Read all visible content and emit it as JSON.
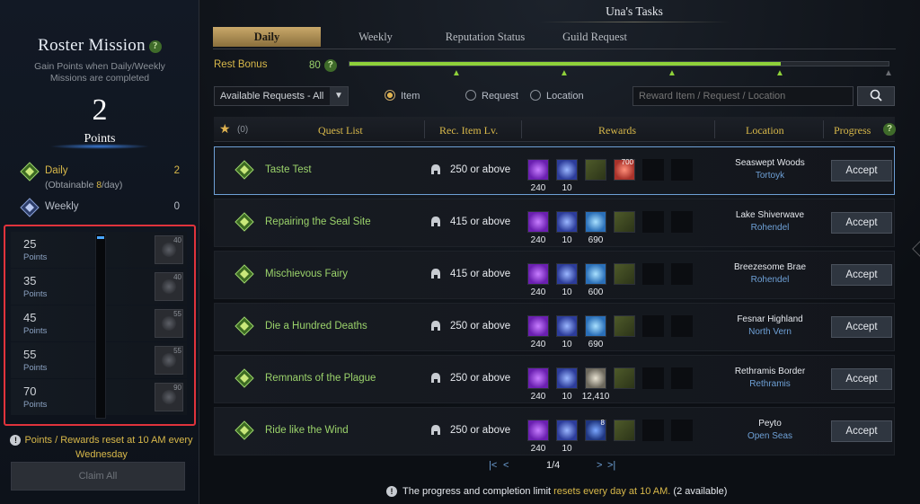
{
  "window": {
    "title": "Una's Tasks"
  },
  "colors": {
    "accent_gold": "#d9b94a",
    "quest_green": "#9bd36b",
    "region_blue": "#6ea0d6",
    "highlight_red": "#e0333c",
    "rest_bar": "#8fd13a"
  },
  "roster": {
    "title": "Roster Mission",
    "help": "?",
    "description": "Gain Points when Daily/Weekly Missions are completed",
    "points_value": "2",
    "points_label": "Points",
    "daily_label": "Daily",
    "daily_value": "2",
    "daily_sub_pre": "(Obtainable ",
    "daily_sub_num": "8",
    "daily_sub_post": "/day)",
    "weekly_label": "Weekly",
    "weekly_value": "0",
    "tiers": [
      {
        "points": "25",
        "label": "Points",
        "reward_qty": "40"
      },
      {
        "points": "35",
        "label": "Points",
        "reward_qty": "40"
      },
      {
        "points": "45",
        "label": "Points",
        "reward_qty": "55"
      },
      {
        "points": "55",
        "label": "Points",
        "reward_qty": "55"
      },
      {
        "points": "70",
        "label": "Points",
        "reward_qty": "90"
      }
    ],
    "progress_fraction": 0.03,
    "reset_note": "Points / Rewards reset at 10 AM every Wednesday",
    "claim_all": "Claim All"
  },
  "tabs": [
    {
      "label": "Daily",
      "active": true
    },
    {
      "label": "Weekly",
      "active": false
    },
    {
      "label": "Reputation Status",
      "active": false
    },
    {
      "label": "Guild Request",
      "active": false
    }
  ],
  "rest_bonus": {
    "label": "Rest Bonus",
    "value": "80",
    "help": "?",
    "fraction": 0.8
  },
  "filters": {
    "select_value": "Available Requests - All",
    "radio_item": "Item",
    "radio_request": "Request",
    "radio_location": "Location",
    "selected_radio": "Item",
    "search_placeholder": "Reward Item / Request / Location"
  },
  "table": {
    "fav_count": "(0)",
    "headers": {
      "quest": "Quest List",
      "level": "Rec. Item Lv.",
      "rewards": "Rewards",
      "location": "Location",
      "progress": "Progress",
      "help": "?"
    },
    "accept_label": "Accept",
    "rows": [
      {
        "name": "Taste Test",
        "level": "250 or above",
        "location": "Seaswept Woods",
        "region": "Tortoyk",
        "rewards": [
          {
            "icon": "purple-gem-icon",
            "qty": "240"
          },
          {
            "icon": "blue-gem-icon",
            "qty": "10"
          },
          {
            "icon": "feather-icon",
            "qty": ""
          },
          {
            "icon": "food-icon",
            "qty": "",
            "badge": "700"
          }
        ]
      },
      {
        "name": "Repairing the Seal Site",
        "level": "415 or above",
        "location": "Lake Shiverwave",
        "region": "Rohendel",
        "rewards": [
          {
            "icon": "purple-gem-icon",
            "qty": "240"
          },
          {
            "icon": "blue-gem-icon",
            "qty": "10"
          },
          {
            "icon": "blue-crystal-icon",
            "qty": "690"
          },
          {
            "icon": "feather-icon",
            "qty": ""
          }
        ]
      },
      {
        "name": "Mischievous Fairy",
        "level": "415 or above",
        "location": "Breezesome Brae",
        "region": "Rohendel",
        "rewards": [
          {
            "icon": "purple-gem-icon",
            "qty": "240"
          },
          {
            "icon": "blue-gem-icon",
            "qty": "10"
          },
          {
            "icon": "blue-crystal-icon",
            "qty": "600"
          },
          {
            "icon": "feather-icon",
            "qty": ""
          }
        ]
      },
      {
        "name": "Die a Hundred Deaths",
        "level": "250 or above",
        "location": "Fesnar Highland",
        "region": "North Vern",
        "rewards": [
          {
            "icon": "purple-gem-icon",
            "qty": "240"
          },
          {
            "icon": "blue-gem-icon",
            "qty": "10"
          },
          {
            "icon": "blue-crystal-icon",
            "qty": "690"
          },
          {
            "icon": "feather-icon",
            "qty": ""
          }
        ]
      },
      {
        "name": "Remnants of the Plague",
        "level": "250 or above",
        "location": "Rethramis Border",
        "region": "Rethramis",
        "rewards": [
          {
            "icon": "purple-gem-icon",
            "qty": "240"
          },
          {
            "icon": "blue-gem-icon",
            "qty": "10"
          },
          {
            "icon": "silver-coin-icon",
            "qty": "12,410"
          },
          {
            "icon": "feather-icon",
            "qty": ""
          }
        ]
      },
      {
        "name": "Ride like the Wind",
        "level": "250 or above",
        "location": "Peyto",
        "region": "Open Seas",
        "rewards": [
          {
            "icon": "purple-gem-icon",
            "qty": "240"
          },
          {
            "icon": "blue-gem-icon",
            "qty": "10"
          },
          {
            "icon": "blue-potion-icon",
            "qty": "",
            "badge": "8"
          },
          {
            "icon": "feather-icon",
            "qty": ""
          }
        ]
      }
    ]
  },
  "pager": {
    "first": "|<",
    "prev": "<",
    "text": "1/4",
    "next": ">",
    "last": ">|"
  },
  "footer": {
    "pre": "The progress and completion limit ",
    "highlight": "resets every day at 10 AM.",
    "post": " (2 available)"
  }
}
